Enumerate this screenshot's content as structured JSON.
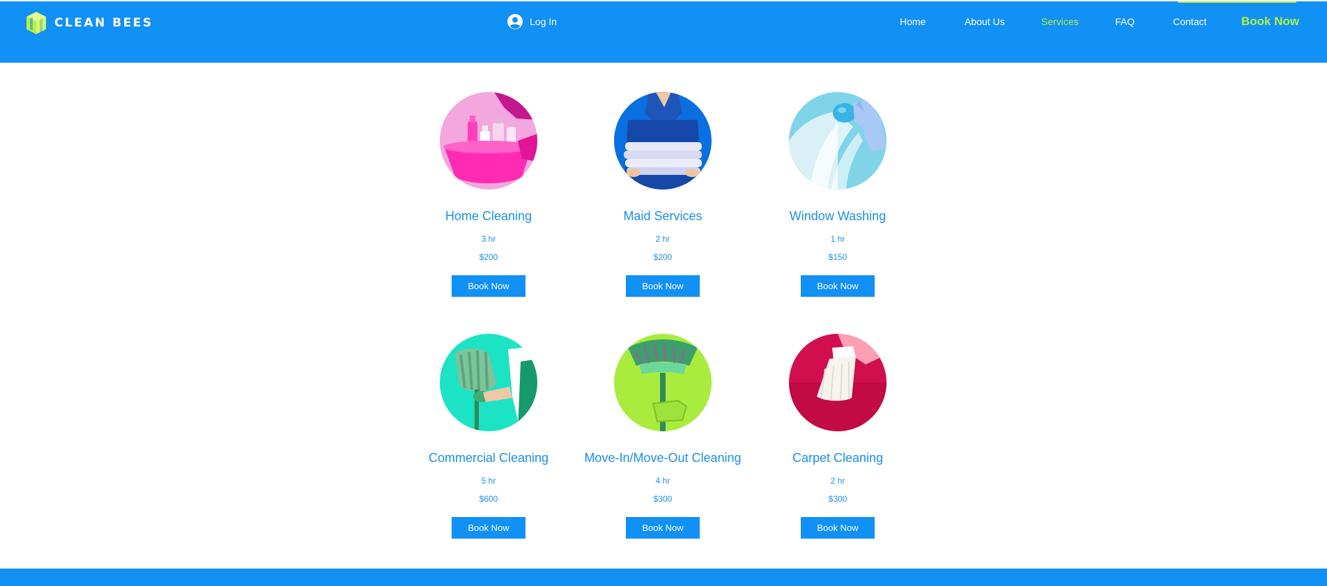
{
  "brand": {
    "name": "CLEAN BEES"
  },
  "header": {
    "login_label": "Log In",
    "nav": [
      {
        "label": "Home",
        "active": false
      },
      {
        "label": "About Us",
        "active": false
      },
      {
        "label": "Services",
        "active": true
      },
      {
        "label": "FAQ",
        "active": false
      },
      {
        "label": "Contact",
        "active": false
      }
    ],
    "cta_label": "Book Now"
  },
  "services": [
    {
      "title": "Home Cleaning",
      "duration": "3 hr",
      "price": "$200",
      "button": "Book Now",
      "image": "pink-cleaning-supplies-bucket"
    },
    {
      "title": "Maid Services",
      "duration": "2 hr",
      "price": "$200",
      "button": "Book Now",
      "image": "folded-towels"
    },
    {
      "title": "Window Washing",
      "duration": "1 hr",
      "price": "$150",
      "button": "Book Now",
      "image": "sponge-on-window"
    },
    {
      "title": "Commercial Cleaning",
      "duration": "5 hr",
      "price": "$600",
      "button": "Book Now",
      "image": "green-mop"
    },
    {
      "title": "Move-In/Move-Out Cleaning",
      "duration": "4 hr",
      "price": "$300",
      "button": "Book Now",
      "image": "green-broom"
    },
    {
      "title": "Carpet Cleaning",
      "duration": "2 hr",
      "price": "$300",
      "button": "Book Now",
      "image": "brush-on-red-carpet"
    }
  ],
  "colors": {
    "brand_blue": "#1190f5",
    "accent_green": "#b6f23d",
    "text_blue": "#1a8fe8"
  }
}
